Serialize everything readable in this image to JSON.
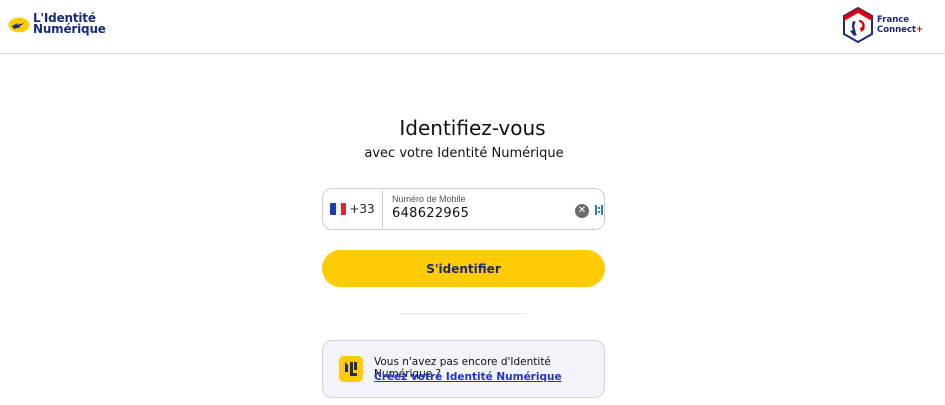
{
  "header": {
    "brand_line1": "L'Identité",
    "brand_line2": "Numérique",
    "franceconnect_line1": "France",
    "franceconnect_line2": "Connect",
    "franceconnect_plus": "+"
  },
  "main": {
    "title": "Identifiez-vous",
    "subtitle": "avec votre Identité Numérique"
  },
  "phone": {
    "country_flag": "flag-fr-icon",
    "dial_code": "+33",
    "label": "Numéro de Mobile",
    "value": "648622965",
    "clear_icon": "clear-icon",
    "clear_glyph": "✕"
  },
  "actions": {
    "submit_label": "S'identifier"
  },
  "signup": {
    "prompt": "Vous n'avez pas encore d'Identité Numérique ?",
    "link_label": "Créez votre Identité Numérique"
  },
  "colors": {
    "accent_yellow": "#ffcb05",
    "brand_navy": "#1b2a7a",
    "link_blue": "#1b35c8",
    "info_bg": "#f2f4fa"
  }
}
